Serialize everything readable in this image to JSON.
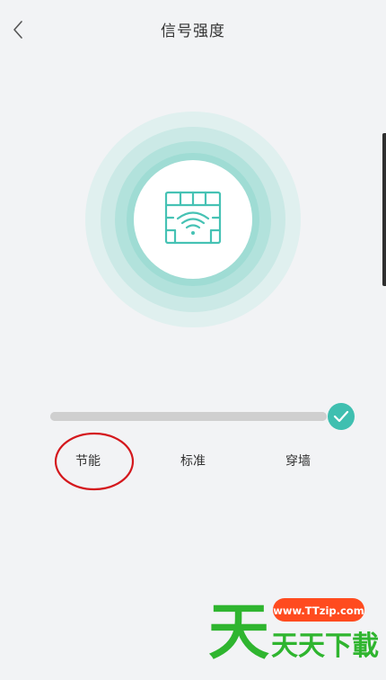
{
  "header": {
    "title": "信号强度",
    "back_icon": "chevron-left-icon"
  },
  "hero": {
    "icon": "firewall-wifi-icon",
    "accent": "#46c2b4",
    "ring_colors": [
      "#e0f0ef",
      "#cbe9e6",
      "#b2e2dc",
      "#9fdcd4"
    ]
  },
  "signal": {
    "options": [
      "节能",
      "标准",
      "穿墙"
    ],
    "selected": "穿墙",
    "level_fraction": 1.0
  },
  "watermark": {
    "url": "www.TTzip.com",
    "text": "天天下載",
    "badge_color": "#ff4b1f",
    "text_color": "#2fb52f"
  }
}
